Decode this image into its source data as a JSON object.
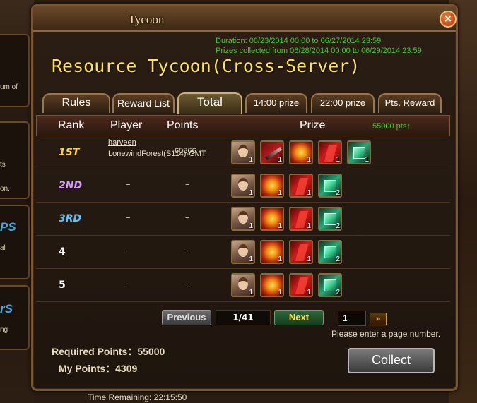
{
  "window": {
    "title": "Tycoon"
  },
  "event": {
    "duration": "Duration: 06/23/2014 00:00 to 06/27/2014 23:59",
    "prizes_collected": "Prizes collected from 06/28/2014 00:00 to 06/29/2014 23:59",
    "title": "Resource Tycoon(Cross-Server)"
  },
  "tabs": [
    {
      "label": "Rules",
      "active": false
    },
    {
      "label": "Reward List",
      "active": false
    },
    {
      "label": "Total",
      "active": true
    },
    {
      "label": "14:00 prize",
      "active": false
    },
    {
      "label": "22:00 prize",
      "active": false
    },
    {
      "label": "Pts. Reward",
      "active": false
    }
  ],
  "table": {
    "headers": {
      "rank": "Rank",
      "player": "Player",
      "points": "Points",
      "prize": "Prize"
    },
    "pts_note": "55000 pts↑",
    "rows": [
      {
        "rank": "1ST",
        "player_name": "harveen",
        "player_server": "LonewindForest(S114)-GMT",
        "points": "60866",
        "prizes": [
          {
            "icon": "hero-portrait",
            "qty": "1"
          },
          {
            "icon": "sword",
            "qty": "1"
          },
          {
            "icon": "fire-orb",
            "qty": "1"
          },
          {
            "icon": "red-crystal",
            "qty": "1"
          },
          {
            "icon": "green-gem",
            "qty": "1"
          }
        ]
      },
      {
        "rank": "2ND",
        "player_name": "–",
        "points": "–",
        "prizes": [
          {
            "icon": "hero-portrait",
            "qty": "1"
          },
          {
            "icon": "fire-orb",
            "qty": "1"
          },
          {
            "icon": "red-crystal",
            "qty": "1"
          },
          {
            "icon": "green-gem",
            "qty": "2"
          }
        ]
      },
      {
        "rank": "3RD",
        "player_name": "–",
        "points": "–",
        "prizes": [
          {
            "icon": "hero-portrait",
            "qty": "1"
          },
          {
            "icon": "fire-orb",
            "qty": "1"
          },
          {
            "icon": "red-crystal",
            "qty": "1"
          },
          {
            "icon": "green-gem",
            "qty": "2"
          }
        ]
      },
      {
        "rank": "4",
        "player_name": "–",
        "points": "–",
        "prizes": [
          {
            "icon": "hero-portrait",
            "qty": "1"
          },
          {
            "icon": "fire-orb",
            "qty": "1"
          },
          {
            "icon": "red-crystal",
            "qty": "1"
          },
          {
            "icon": "green-gem",
            "qty": "2"
          }
        ]
      },
      {
        "rank": "5",
        "player_name": "–",
        "points": "–",
        "prizes": [
          {
            "icon": "hero-portrait",
            "qty": "1"
          },
          {
            "icon": "fire-orb",
            "qty": "1"
          },
          {
            "icon": "red-crystal",
            "qty": "1"
          },
          {
            "icon": "green-gem",
            "qty": "2"
          }
        ]
      }
    ]
  },
  "pagination": {
    "previous_label": "Previous",
    "next_label": "Next",
    "page_indicator": "1/41",
    "page_input_value": "1",
    "go_label": "»",
    "hint": "Please enter a page number."
  },
  "footer": {
    "required_points": "Required Points：55000",
    "my_points": "My Points：4309",
    "collect_label": "Collect",
    "time_remaining": "Time Remaining:   22:15:50"
  },
  "side": {
    "text1": "um of",
    "text2": "ts",
    "text3": "on.",
    "text4": "al",
    "text5": "ng",
    "blue1": "PS",
    "blue2": "rS"
  }
}
